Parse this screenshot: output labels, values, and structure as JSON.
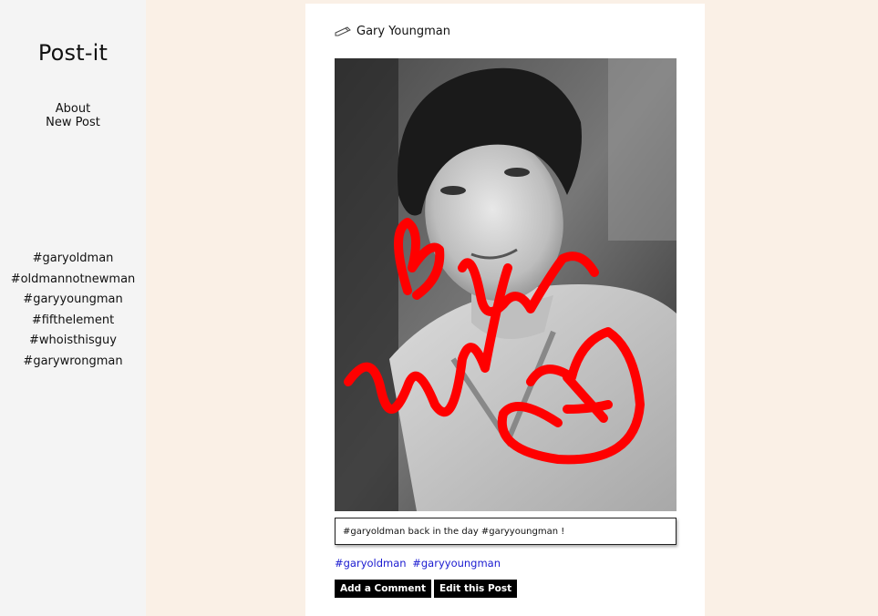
{
  "app": {
    "title": "Post-it"
  },
  "nav": {
    "about": "About",
    "new_post": "New Post"
  },
  "sidebar_tags": [
    "#garyoldman",
    "#oldmannotnewman",
    "#garyyoungman",
    "#fifthelement",
    "#whoisthisguy",
    "#garywrongman"
  ],
  "post": {
    "title": "Gary Youngman",
    "caption": "#garyoldman back in the day #garyyoungman !",
    "tags": [
      "#garyoldman",
      "#garyyoungman"
    ],
    "actions": {
      "comment": "Add a Comment",
      "edit": "Edit this Post"
    }
  },
  "colors": {
    "sidebar_bg": "#f4f4f4",
    "page_bg": "#faf0e6",
    "link": "#1a1ad0",
    "doodle": "#ff0000"
  }
}
